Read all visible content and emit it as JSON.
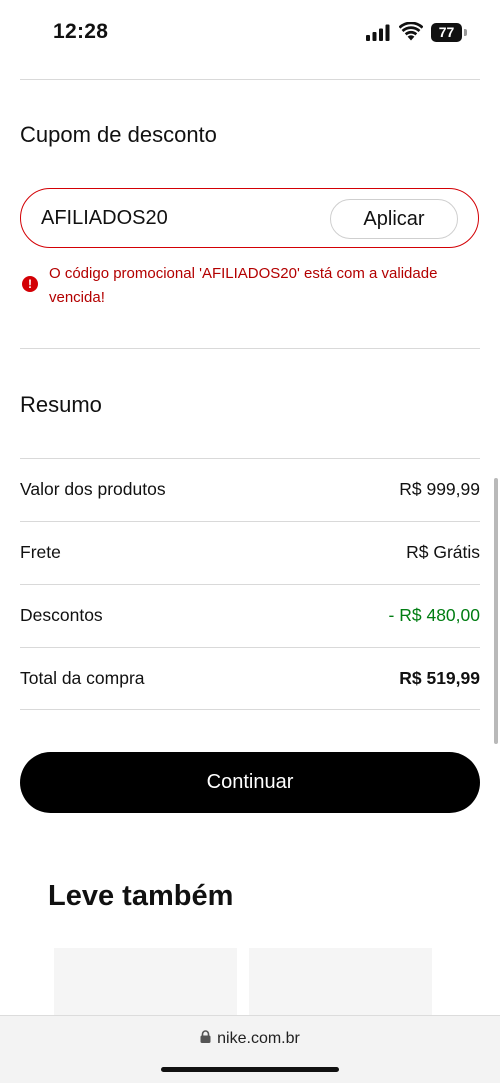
{
  "status_bar": {
    "time": "12:28",
    "battery": "77"
  },
  "coupon": {
    "title": "Cupom de desconto",
    "code": "AFILIADOS20",
    "apply_label": "Aplicar",
    "error_message": "O código promocional 'AFILIADOS20' está com a validade vencida!",
    "error_color": "#d30005"
  },
  "summary": {
    "title": "Resumo",
    "rows": [
      {
        "label": "Valor dos produtos",
        "value": "R$ 999,99"
      },
      {
        "label": "Frete",
        "value": "R$ Grátis"
      },
      {
        "label": "Descontos",
        "value": "- R$ 480,00"
      },
      {
        "label": "Total da compra",
        "value": "R$ 519,99"
      }
    ],
    "discount_color": "#007d12"
  },
  "continue_label": "Continuar",
  "also_buy": {
    "title": "Leve também"
  },
  "browser": {
    "url": "nike.com.br"
  }
}
